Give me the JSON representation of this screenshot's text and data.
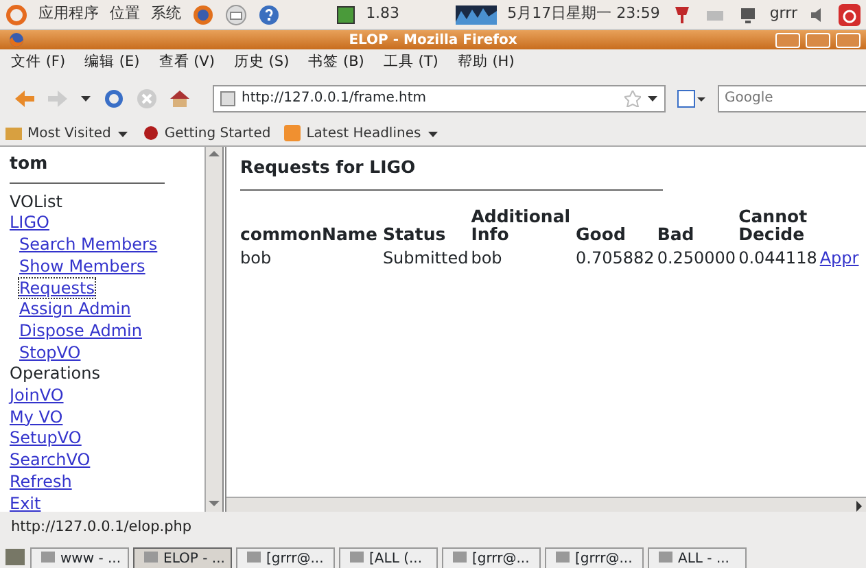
{
  "top_panel": {
    "menus": [
      "应用程序",
      "位置",
      "系统"
    ],
    "cpu": "1.83",
    "clock": "5月17日星期一 23:59",
    "user": "grrr"
  },
  "window": {
    "title": "ELOP - Mozilla Firefox"
  },
  "menubar": [
    "文件 (F)",
    "编辑 (E)",
    "查看 (V)",
    "历史 (S)",
    "书签 (B)",
    "工具 (T)",
    "帮助 (H)"
  ],
  "toolbar": {
    "url": "http://127.0.0.1/frame.htm",
    "search_placeholder": "Google"
  },
  "bookmarks": [
    {
      "label": "Most Visited",
      "dropdown": true
    },
    {
      "label": "Getting Started",
      "dropdown": false
    },
    {
      "label": "Latest Headlines",
      "dropdown": true
    }
  ],
  "sidebar": {
    "user": "tom",
    "items": [
      {
        "label": "VOList",
        "kind": "heading"
      },
      {
        "label": "LIGO",
        "kind": "link",
        "children": [
          {
            "label": "Search Members",
            "focused": false
          },
          {
            "label": "Show Members",
            "focused": false
          },
          {
            "label": "Requests",
            "focused": true
          },
          {
            "label": "Assign Admin",
            "focused": false
          },
          {
            "label": "Dispose Admin",
            "focused": false
          },
          {
            "label": "StopVO",
            "focused": false
          }
        ]
      },
      {
        "label": "Operations",
        "kind": "heading"
      },
      {
        "label": "JoinVO",
        "kind": "link"
      },
      {
        "label": "My VO",
        "kind": "link"
      },
      {
        "label": "SetupVO",
        "kind": "link"
      },
      {
        "label": "SearchVO",
        "kind": "link"
      },
      {
        "label": "Refresh",
        "kind": "link"
      },
      {
        "label": "Exit",
        "kind": "link"
      }
    ]
  },
  "main": {
    "title": "Requests for LIGO",
    "table": {
      "columns": [
        "commonName",
        "Status",
        "Additional Info",
        "Good",
        "Bad",
        "Cannot Decide"
      ],
      "rows": [
        {
          "cells": [
            "bob",
            "Submitted",
            "bob",
            "0.705882",
            "0.250000",
            "0.044118"
          ],
          "action": "Appr"
        }
      ]
    }
  },
  "status_bar": "http://127.0.0.1/elop.php",
  "taskbar": [
    {
      "label": "www - ...",
      "selected": false
    },
    {
      "label": "ELOP - ...",
      "selected": true
    },
    {
      "label": "[grrr@...",
      "selected": false
    },
    {
      "label": "[ALL (...",
      "selected": false
    },
    {
      "label": "[grrr@...",
      "selected": false
    },
    {
      "label": "[grrr@...",
      "selected": false
    },
    {
      "label": "ALL - ...",
      "selected": false
    }
  ]
}
